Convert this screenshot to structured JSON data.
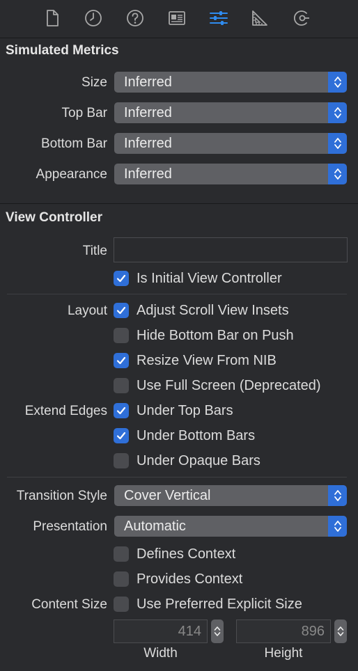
{
  "tabs": [
    {
      "icon": "file-icon",
      "active": false
    },
    {
      "icon": "history-clock-icon",
      "active": false
    },
    {
      "icon": "help-icon",
      "active": false
    },
    {
      "icon": "identity-card-icon",
      "active": false
    },
    {
      "icon": "attributes-sliders-icon",
      "active": true
    },
    {
      "icon": "size-ruler-icon",
      "active": false
    },
    {
      "icon": "connections-icon",
      "active": false
    }
  ],
  "simulated_metrics": {
    "title": "Simulated Metrics",
    "size": {
      "label": "Size",
      "value": "Inferred"
    },
    "top_bar": {
      "label": "Top Bar",
      "value": "Inferred"
    },
    "bottom_bar": {
      "label": "Bottom Bar",
      "value": "Inferred"
    },
    "appearance": {
      "label": "Appearance",
      "value": "Inferred"
    }
  },
  "view_controller": {
    "title": "View Controller",
    "title_field": {
      "label": "Title",
      "value": ""
    },
    "is_initial": {
      "label": "Is Initial View Controller",
      "checked": true
    },
    "layout_label": "Layout",
    "adjust_scroll": {
      "label": "Adjust Scroll View Insets",
      "checked": true
    },
    "hide_bottom_bar": {
      "label": "Hide Bottom Bar on Push",
      "checked": false
    },
    "resize_from_nib": {
      "label": "Resize View From NIB",
      "checked": true
    },
    "full_screen": {
      "label": "Use Full Screen (Deprecated)",
      "checked": false
    },
    "extend_edges_label": "Extend Edges",
    "under_top": {
      "label": "Under Top Bars",
      "checked": true
    },
    "under_bottom": {
      "label": "Under Bottom Bars",
      "checked": true
    },
    "under_opaque": {
      "label": "Under Opaque Bars",
      "checked": false
    },
    "transition": {
      "label": "Transition Style",
      "value": "Cover Vertical"
    },
    "presentation": {
      "label": "Presentation",
      "value": "Automatic"
    },
    "defines_context": {
      "label": "Defines Context",
      "checked": false
    },
    "provides_context": {
      "label": "Provides Context",
      "checked": false
    },
    "content_size_label": "Content Size",
    "preferred_size": {
      "label": "Use Preferred Explicit Size",
      "checked": false
    },
    "width": {
      "value": "414",
      "label": "Width"
    },
    "height": {
      "value": "896",
      "label": "Height"
    }
  },
  "colors": {
    "accent": "#2f6fd8",
    "background": "#2a2b2e",
    "popup": "#5f6064"
  }
}
